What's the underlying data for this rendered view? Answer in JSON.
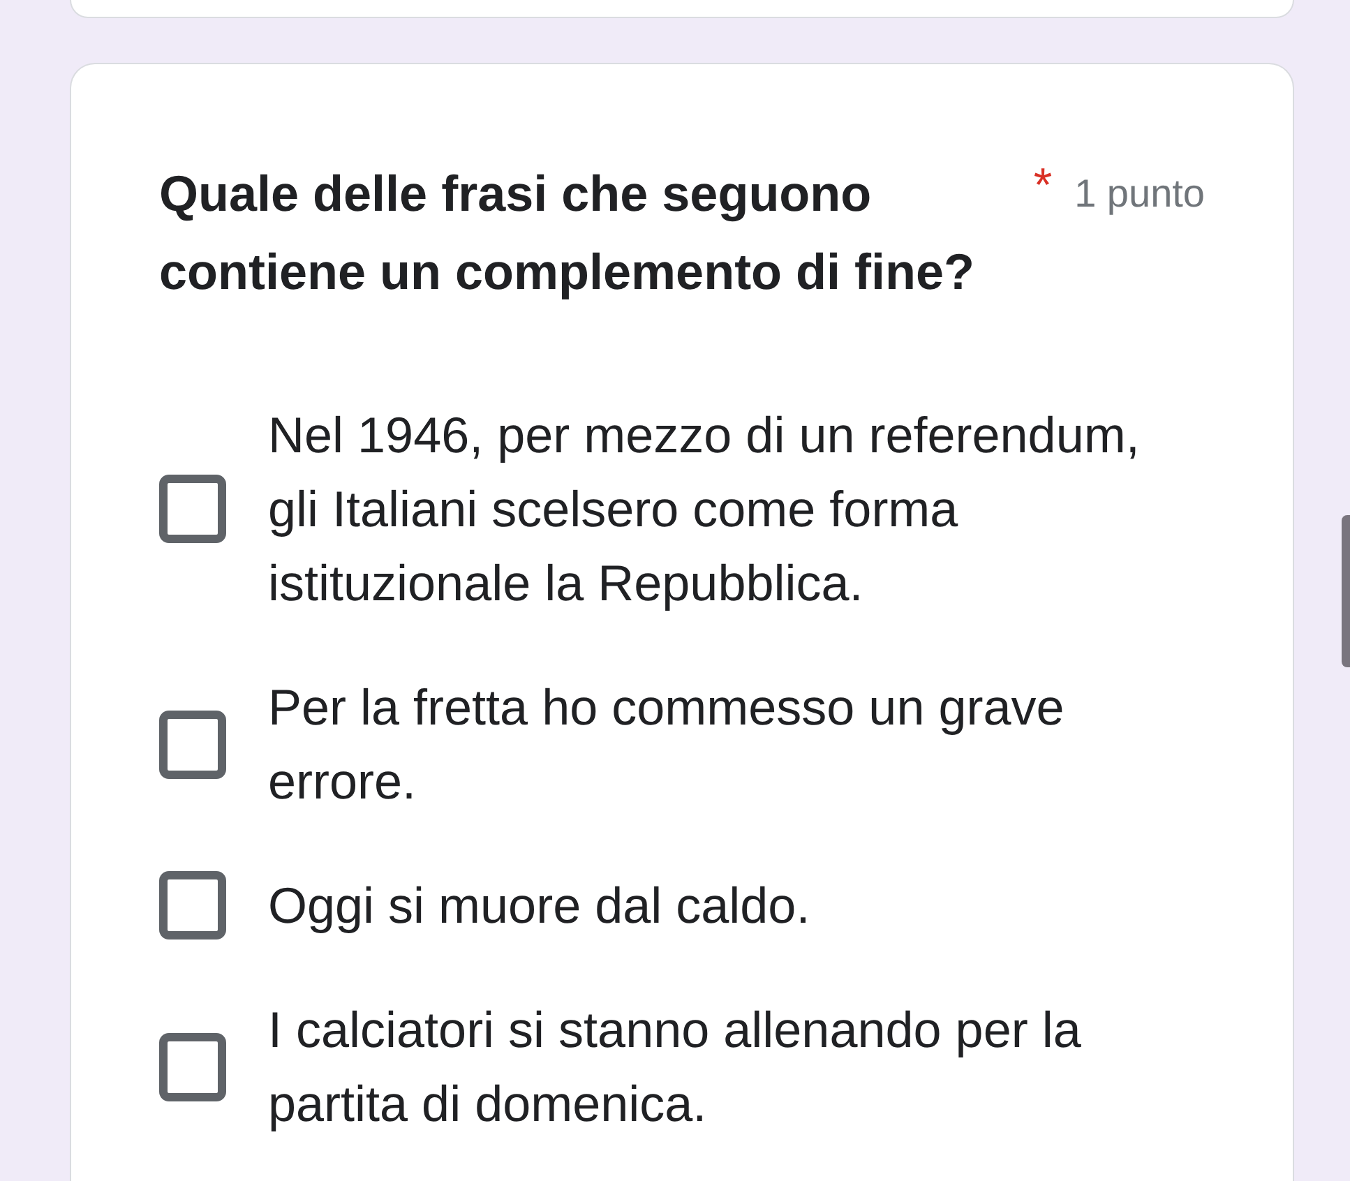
{
  "question": {
    "title": "Quale delle frasi che seguono contiene un complemento di fine?",
    "required_mark": "*",
    "points": "1 punto"
  },
  "options": [
    {
      "label": "Nel 1946, per mezzo di un referendum, gli Italiani scelsero come forma istituzionale la Repubblica.",
      "checked": false
    },
    {
      "label": "Per la fretta ho commesso un grave errore.",
      "checked": false
    },
    {
      "label": "Oggi si muore dal caldo.",
      "checked": false
    },
    {
      "label": "I calciatori si stanno allenando per la partita di domenica.",
      "checked": false
    }
  ]
}
